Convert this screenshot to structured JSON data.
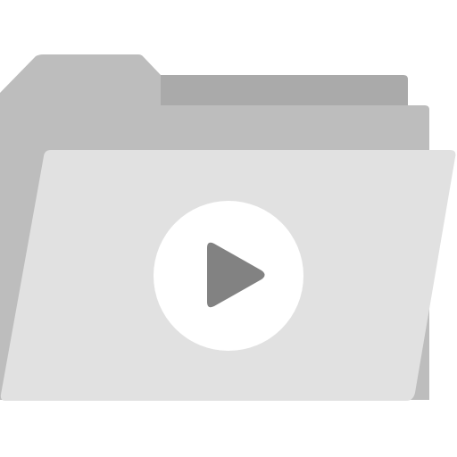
{
  "icon": {
    "name": "video-folder-icon",
    "colors": {
      "background": "#ffffff",
      "folder_back": "#BDBDBD",
      "folder_tab_shadow": "#AAAAAA",
      "folder_sheet": "#BDBDBD",
      "folder_front": "#E1E1E1",
      "play_circle": "#FFFFFF",
      "play_triangle": "#828282"
    }
  }
}
